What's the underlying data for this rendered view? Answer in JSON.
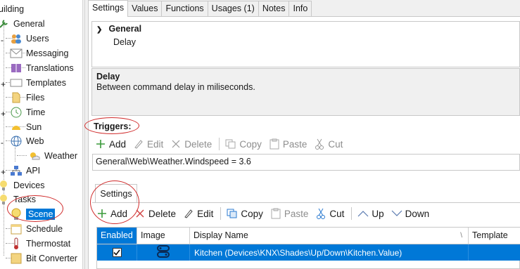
{
  "tree": {
    "items": [
      {
        "label": "uilding",
        "icon": "building-icon"
      },
      {
        "label": "General",
        "icon": "wrench-icon"
      },
      {
        "label": "Users",
        "icon": "users-icon"
      },
      {
        "label": "Messaging",
        "icon": "envelope-icon"
      },
      {
        "label": "Translations",
        "icon": "book-icon"
      },
      {
        "label": "Templates",
        "icon": "template-icon"
      },
      {
        "label": "Files",
        "icon": "folder-icon"
      },
      {
        "label": "Time",
        "icon": "clock-icon"
      },
      {
        "label": "Sun",
        "icon": "sun-icon"
      },
      {
        "label": "Web",
        "icon": "globe-icon"
      },
      {
        "label": "Weather",
        "icon": "weather-icon"
      },
      {
        "label": "API",
        "icon": "api-icon"
      },
      {
        "label": "Devices",
        "icon": "lightbulb-icon"
      },
      {
        "label": "Tasks",
        "icon": "tasks-icon"
      },
      {
        "label": "Scene",
        "icon": "scene-icon"
      },
      {
        "label": "Schedule",
        "icon": "calendar-icon"
      },
      {
        "label": "Thermostat",
        "icon": "thermostat-icon"
      },
      {
        "label": "Bit Converter",
        "icon": "converter-icon"
      }
    ],
    "selected": "Scene"
  },
  "tabs": [
    {
      "label": "Settings",
      "active": true
    },
    {
      "label": "Values"
    },
    {
      "label": "Functions"
    },
    {
      "label": "Usages (1)"
    },
    {
      "label": "Notes"
    },
    {
      "label": "Info"
    }
  ],
  "props": {
    "category": "General",
    "item": "Delay"
  },
  "description": {
    "title": "Delay",
    "text": "Between command delay in miliseconds."
  },
  "triggers": {
    "label": "Triggers:",
    "toolbar": {
      "add": "Add",
      "edit": "Edit",
      "delete": "Delete",
      "copy": "Copy",
      "paste": "Paste",
      "cut": "Cut"
    },
    "value": "General\\Web\\Weather.Windspeed = 3.6"
  },
  "settings": {
    "tab_label": "Settings",
    "toolbar": {
      "add": "Add",
      "delete": "Delete",
      "edit": "Edit",
      "copy": "Copy",
      "paste": "Paste",
      "cut": "Cut",
      "up": "Up",
      "down": "Down"
    },
    "grid": {
      "columns": [
        "Enabled",
        "Image",
        "Display Name",
        "Template"
      ],
      "sort_glyph": "\\",
      "rows": [
        {
          "enabled": true,
          "image_icon": "shades-icon",
          "display_name": "Kitchen (Devices\\KNX\\Shades\\Up/Down\\Kitchen.Value)"
        }
      ]
    }
  },
  "colors": {
    "selection": "#0078d7",
    "annotation": "#d02a2a",
    "add_green": "#3a9a3a",
    "delete_red": "#d04040",
    "copy_blue": "#2a7ad0"
  }
}
